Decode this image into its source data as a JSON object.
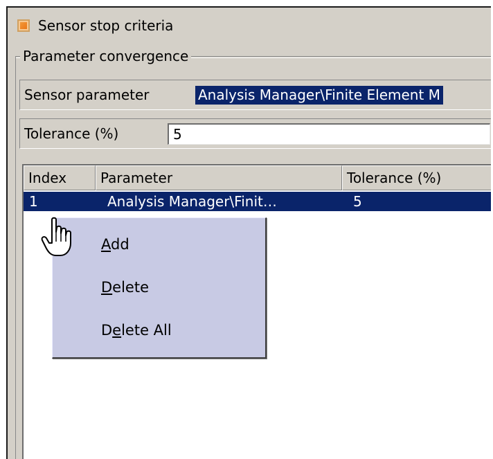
{
  "stop_criteria": {
    "checkbox_checked": true,
    "label": "Sensor stop criteria"
  },
  "group": {
    "title": "Parameter convergence"
  },
  "sensor": {
    "label": "Sensor parameter",
    "value": "Analysis Manager\\Finite Element M"
  },
  "tolerance": {
    "label": "Tolerance (%)",
    "value": "5"
  },
  "table": {
    "headers": [
      "Index",
      "Parameter",
      "Tolerance (%)"
    ],
    "rows": [
      {
        "index": "1",
        "parameter": "Analysis Manager\\Finit…",
        "tolerance": "5"
      }
    ],
    "selected_row": 0
  },
  "context_menu": {
    "items": [
      {
        "label": "Add",
        "mnemonic": "A"
      },
      {
        "label": "Delete",
        "mnemonic": "D"
      },
      {
        "label": "Delete All",
        "mnemonic": "e"
      }
    ]
  },
  "icons": {
    "cursor": "hand-pointer-icon",
    "checkbox": "checkbox-checked-icon"
  },
  "colors": {
    "panel": "#d4d0c8",
    "selection": "#0a246a",
    "menu_bg": "#c8cae4",
    "checkbox_fill": "#e87010"
  }
}
